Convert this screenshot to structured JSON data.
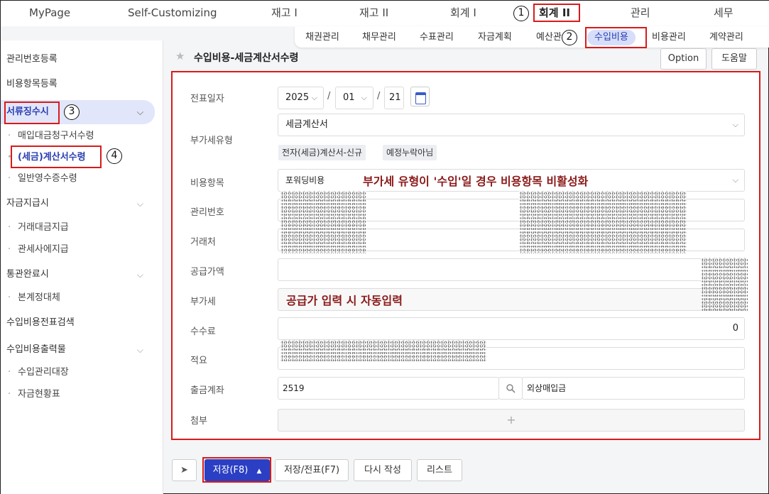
{
  "top_nav": [
    {
      "label": "MyPage"
    },
    {
      "label": "Self-Customizing"
    },
    {
      "label": "재고 I"
    },
    {
      "label": "재고 II"
    },
    {
      "label": "회계 I"
    },
    {
      "label": "회계 II"
    },
    {
      "label": "관리"
    },
    {
      "label": "세무"
    }
  ],
  "sub_nav": [
    {
      "label": "채권관리"
    },
    {
      "label": "채무관리"
    },
    {
      "label": "수표관리"
    },
    {
      "label": "자금계획"
    },
    {
      "label": "예산관"
    },
    {
      "label": "수입비용"
    },
    {
      "label": "비용관리"
    },
    {
      "label": "계약관리"
    }
  ],
  "sidebar": {
    "items": [
      {
        "label": "관리번호등록"
      },
      {
        "label": "비용항목등록"
      },
      {
        "label": "서류징수시"
      },
      {
        "label": "매입대금청구서수령"
      },
      {
        "label": "(세금)계산서수령"
      },
      {
        "label": "일반영수증수령"
      },
      {
        "label": "자금지급시"
      },
      {
        "label": "거래대금지급"
      },
      {
        "label": "관세사에지급"
      },
      {
        "label": "통관완료시"
      },
      {
        "label": "본계정대체"
      },
      {
        "label": "수입비용전표검색"
      },
      {
        "label": "수입비용출력물"
      },
      {
        "label": "수입관리대장"
      },
      {
        "label": "자금현황표"
      }
    ],
    "sub_bullet": "·",
    "chevron": "⌵"
  },
  "header": {
    "title": "수입비용-세금계산서수령",
    "option_label": "Option",
    "help_label": "도움말",
    "star": "★"
  },
  "form": {
    "date_label": "전표일자",
    "date_year": "2025",
    "date_month": "01",
    "date_day": "21",
    "date_sep": "/",
    "vat_type_label": "부가세유형",
    "vat_type_value": "세금계산서",
    "tags": [
      "전자(세금)계산서-신규",
      "예정누락아님"
    ],
    "cost_item_label": "비용항목",
    "cost_item_value": "포워딩비용",
    "mgmt_no_label": "관리번호",
    "vendor_label": "거래처",
    "supply_label": "공급가액",
    "vat_label": "부가세",
    "fee_label": "수수료",
    "fee_value": "0",
    "memo_label": "적요",
    "account_label": "출금계좌",
    "account_no": "2519",
    "account_name": "외상매입금",
    "attach_label": "첨부",
    "attach_plus": "+"
  },
  "annotations": {
    "note_cost_item": "부가세 유형이 '수입'일 경우 비용항목 비활성화",
    "note_vat": "공급가 입력 시 자동입력",
    "markers": [
      "1",
      "2",
      "3",
      "4"
    ]
  },
  "bottom_bar": {
    "send_icon": "➤",
    "save_label": "저장(F8)",
    "save_arrow": "▲",
    "save_slip_label": "저장/전표(F7)",
    "rewrite_label": "다시 작성",
    "list_label": "리스트"
  },
  "colors": {
    "accent": "#2a3fc4",
    "annotation_red": "#d81b1b",
    "annotation_text": "#8b1a1a",
    "active_bg": "#e2e6fb"
  }
}
